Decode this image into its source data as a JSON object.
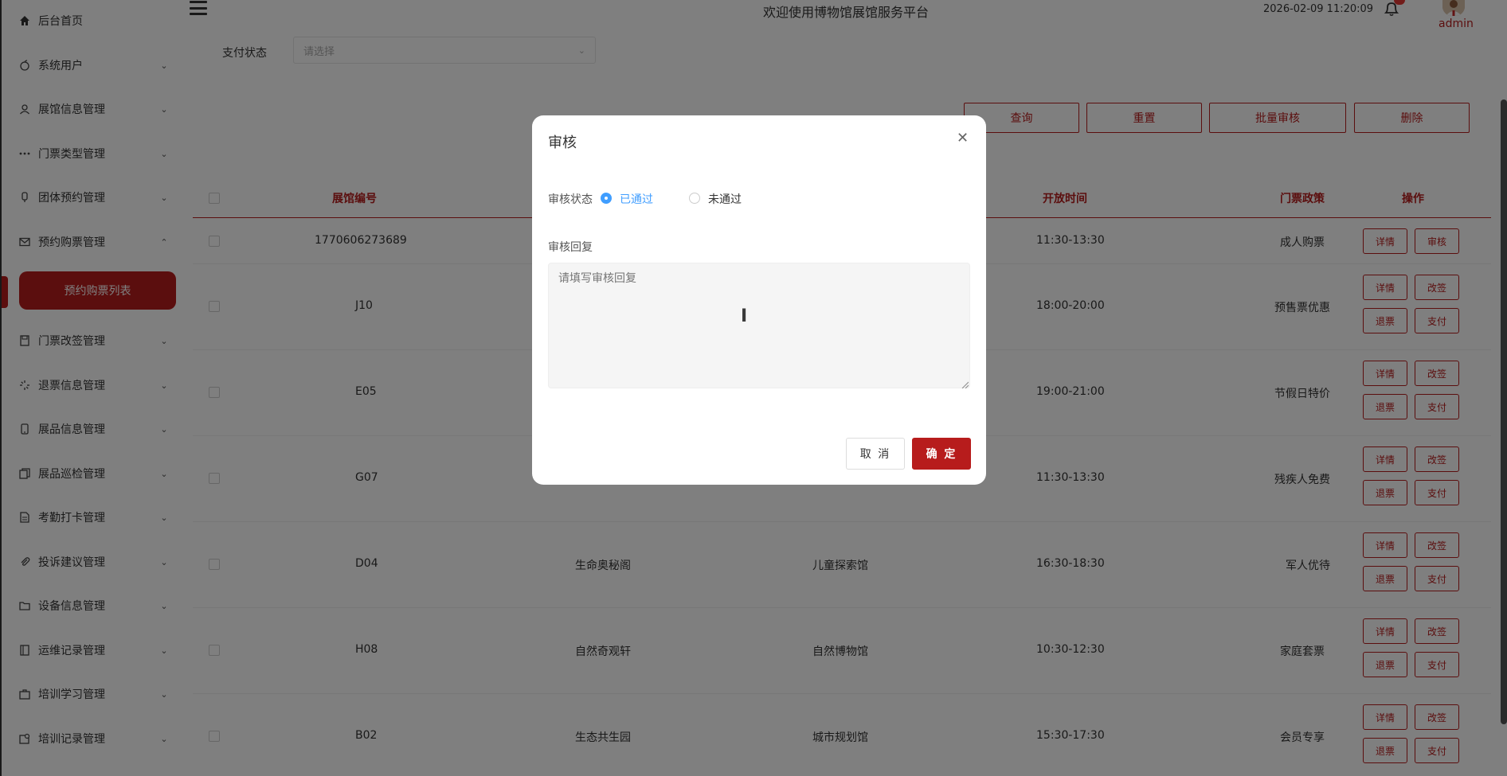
{
  "header": {
    "title": "欢迎使用博物馆展馆服务平台",
    "datetime": "2026-02-09 11:20:09",
    "user": "admin"
  },
  "sidebar": {
    "items": [
      {
        "label": "后台首页",
        "icon": "home-icon"
      },
      {
        "label": "系统用户",
        "icon": "apple-icon"
      },
      {
        "label": "展馆信息管理",
        "icon": "user-icon"
      },
      {
        "label": "门票类型管理",
        "icon": "more-dots-icon"
      },
      {
        "label": "团体预约管理",
        "icon": "mic-icon"
      },
      {
        "label": "预约购票管理",
        "icon": "message-icon"
      },
      {
        "label": "门票改签管理",
        "icon": "save-icon"
      },
      {
        "label": "退票信息管理",
        "icon": "loading-icon"
      },
      {
        "label": "展品信息管理",
        "icon": "phone-icon"
      },
      {
        "label": "展品巡检管理",
        "icon": "copy-icon"
      },
      {
        "label": "考勤打卡管理",
        "icon": "document-icon"
      },
      {
        "label": "投诉建议管理",
        "icon": "paperclip-icon"
      },
      {
        "label": "设备信息管理",
        "icon": "folder-icon"
      },
      {
        "label": "运维记录管理",
        "icon": "notebook-icon"
      },
      {
        "label": "培训学习管理",
        "icon": "suitcase-icon"
      },
      {
        "label": "培训记录管理",
        "icon": "reading-icon"
      }
    ],
    "active_sub": "预约购票列表"
  },
  "filter": {
    "label": "支付状态",
    "placeholder": "请选择"
  },
  "toolbar": {
    "query": "查询",
    "reset": "重置",
    "batch_audit": "批量审核",
    "delete": "删除"
  },
  "table": {
    "headers": {
      "hall_no": "展馆编号",
      "open_time": "开放时间",
      "policy": "门票政策",
      "ops": "操作"
    },
    "rows": [
      {
        "hall_no": "1770606273689",
        "name": "",
        "museum": "",
        "time": "11:30-13:30",
        "policy": "成人购票"
      },
      {
        "hall_no": "J10",
        "name": "",
        "museum": "",
        "time": "18:00-20:00",
        "policy": "预售票优惠"
      },
      {
        "hall_no": "E05",
        "name": "",
        "museum": "",
        "time": "19:00-21:00",
        "policy": "节假日特价"
      },
      {
        "hall_no": "G07",
        "name": "",
        "museum": "",
        "time": "11:30-13:30",
        "policy": "残疾人免费"
      },
      {
        "hall_no": "D04",
        "name": "生命奥秘阁",
        "museum": "儿童探索馆",
        "time": "16:30-18:30",
        "policy": "军人优待"
      },
      {
        "hall_no": "H08",
        "name": "自然奇观轩",
        "museum": "自然博物馆",
        "time": "10:30-12:30",
        "policy": "家庭套票"
      },
      {
        "hall_no": "B02",
        "name": "生态共生园",
        "museum": "城市规划馆",
        "time": "15:30-17:30",
        "policy": "会员专享"
      }
    ],
    "actions": {
      "detail": "详情",
      "audit": "审核",
      "change": "改签",
      "refund": "退票",
      "pay": "支付"
    }
  },
  "dialog": {
    "title": "审核",
    "status_label": "审核状态",
    "option_pass": "已通过",
    "option_fail": "未通过",
    "reply_label": "审核回复",
    "reply_placeholder": "请填写审核回复",
    "cancel": "取 消",
    "confirm": "确 定"
  },
  "colors": {
    "accent": "#b71c1c",
    "radio": "#409eff"
  }
}
